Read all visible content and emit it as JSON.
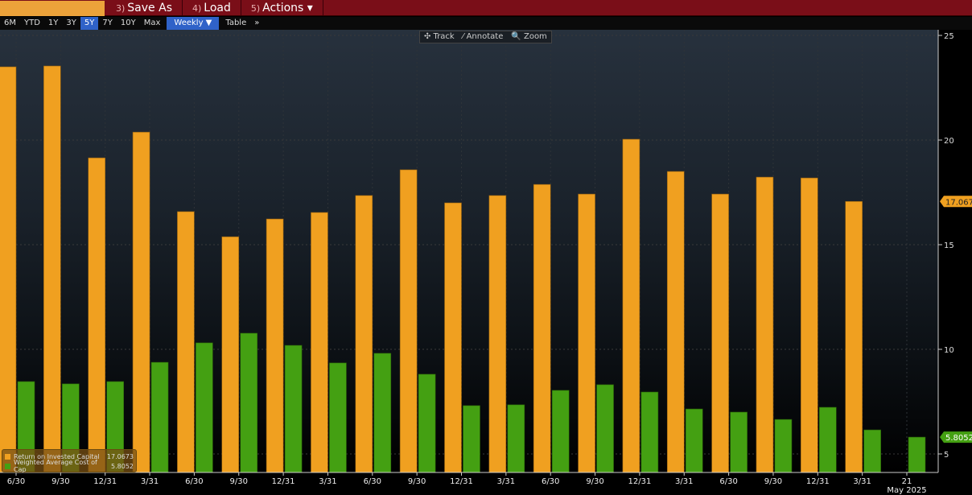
{
  "topbar": {
    "save_as": {
      "num": "3)",
      "label": "Save As"
    },
    "load": {
      "num": "4)",
      "label": "Load"
    },
    "actions": {
      "num": "5)",
      "label": "Actions ▾"
    }
  },
  "toolbar": {
    "ranges": [
      "6M",
      "YTD",
      "1Y",
      "3Y",
      "5Y",
      "7Y",
      "10Y",
      "Max"
    ],
    "selected_range": "5Y",
    "frequency": "Weekly ▼",
    "table": "Table",
    "more": "»"
  },
  "tools": {
    "track": "✣ Track",
    "annotate": "⁄ Annotate",
    "zoom": "🔍 Zoom"
  },
  "colors": {
    "roic": "#f0a020",
    "wacc": "#44a012"
  },
  "chart_data": {
    "type": "bar",
    "categories": [
      "6/30",
      "9/30",
      "12/31",
      "3/31",
      "6/30",
      "9/30",
      "12/31",
      "3/31",
      "6/30",
      "9/30",
      "12/31",
      "3/31",
      "6/30",
      "9/30",
      "12/31",
      "3/31",
      "6/30",
      "9/30",
      "12/31",
      "3/31",
      "21"
    ],
    "x_sublabel": "May 2025",
    "series": [
      {
        "name": "Return on Invested Capital",
        "last": "17.0673",
        "values": [
          23.5,
          23.54,
          19.15,
          20.38,
          16.58,
          15.38,
          16.23,
          16.54,
          17.35,
          18.58,
          17.0,
          17.35,
          17.88,
          17.42,
          20.04,
          18.5,
          17.42,
          18.23,
          18.19,
          17.0673,
          null
        ]
      },
      {
        "name": "Weighted Average Cost of Cap",
        "last": "5.8052",
        "values": [
          8.46,
          8.35,
          8.46,
          9.38,
          10.31,
          10.77,
          10.19,
          9.35,
          9.81,
          8.81,
          7.31,
          7.35,
          8.04,
          8.31,
          7.96,
          7.15,
          7.0,
          6.65,
          7.23,
          6.15,
          5.8052
        ]
      }
    ],
    "yticks": [
      5,
      10,
      15,
      20,
      25
    ],
    "ylim": [
      4.1,
      25
    ],
    "y_axis_side": "right",
    "grid": true,
    "legend_position": "bottom-left"
  }
}
